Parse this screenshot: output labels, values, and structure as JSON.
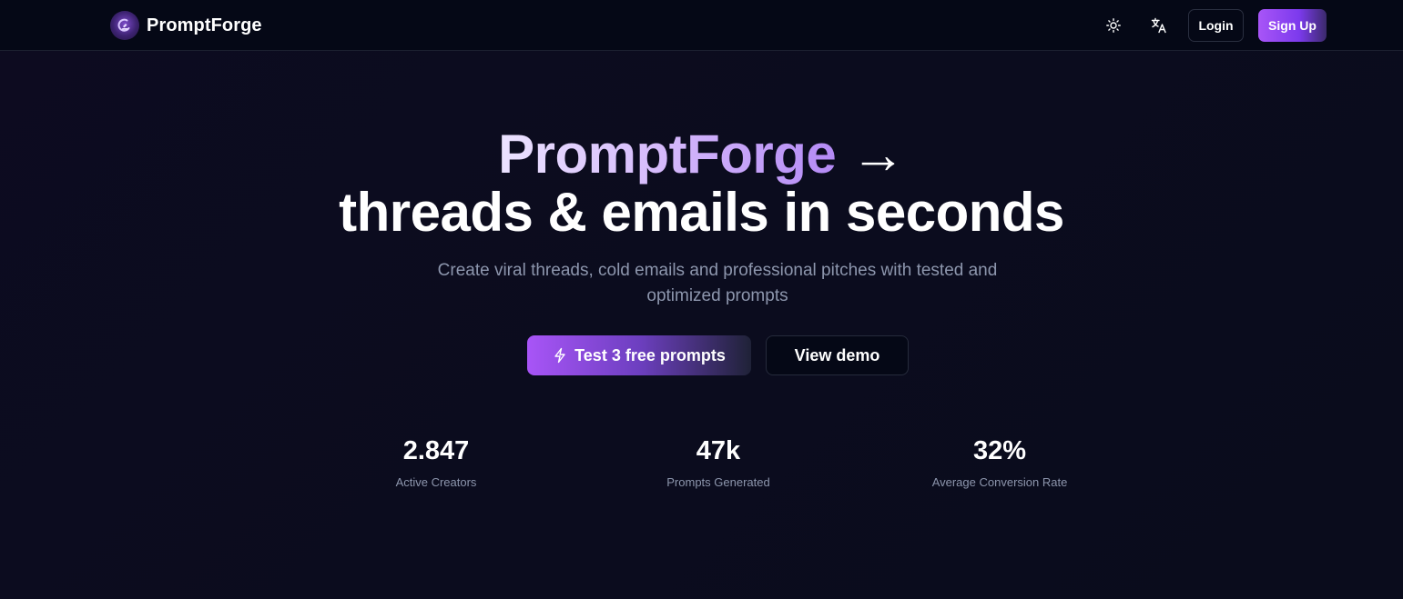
{
  "header": {
    "brand_name": "PromptForge",
    "login_label": "Login",
    "signup_label": "Sign Up",
    "icons": [
      "sun-icon",
      "translate-icon"
    ]
  },
  "hero": {
    "title_brand": "PromptForge",
    "title_arrow": "→",
    "title_line2": "threads & emails in seconds",
    "subtitle": "Create viral threads, cold emails and professional pitches with tested and optimized prompts",
    "primary_cta": "Test 3 free prompts",
    "secondary_cta": "View demo"
  },
  "stats": [
    {
      "value": "2.847",
      "label": "Active Creators"
    },
    {
      "value": "47k",
      "label": "Prompts Generated"
    },
    {
      "value": "32%",
      "label": "Average Conversion Rate"
    }
  ],
  "colors": {
    "background": "#0b0c1d",
    "navbar": "#050816",
    "accent": "#a855f7",
    "muted_text": "#8d96ad"
  }
}
